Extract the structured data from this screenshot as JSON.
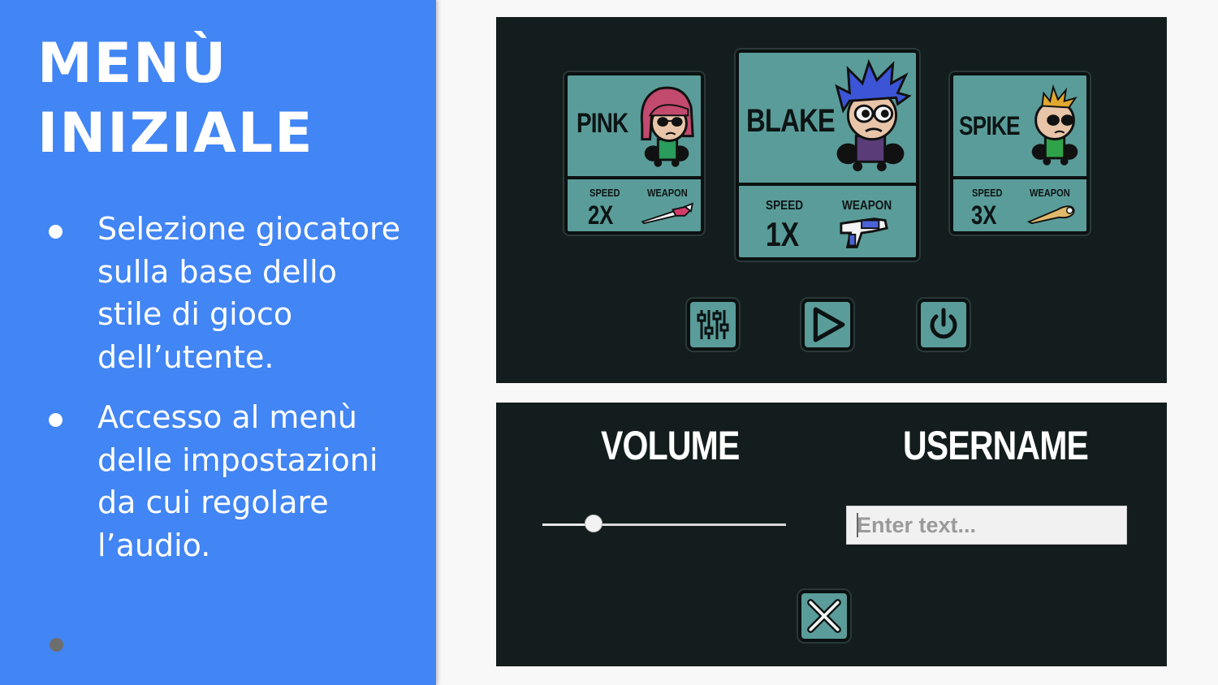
{
  "slide": {
    "title_line1": "MENÙ",
    "title_line2": "INIZIALE",
    "bullets": [
      "Selezione giocatore sulla base dello stile di gioco dell’utente.",
      "Accesso al menù delle impostazioni da cui regolare l’audio."
    ]
  },
  "characters": [
    {
      "name": "PINK",
      "speed_label": "SPEED",
      "speed_value": "2X",
      "weapon_label": "WEAPON",
      "weapon_icon": "spear-icon"
    },
    {
      "name": "BLAKE",
      "speed_label": "SPEED",
      "speed_value": "1X",
      "weapon_label": "WEAPON",
      "weapon_icon": "blaster-gun-icon"
    },
    {
      "name": "SPIKE",
      "speed_label": "SPEED",
      "speed_value": "3X",
      "weapon_label": "WEAPON",
      "weapon_icon": "baseball-bat-icon"
    }
  ],
  "menu_buttons": [
    {
      "icon": "sliders-icon"
    },
    {
      "icon": "play-icon"
    },
    {
      "icon": "power-icon"
    }
  ],
  "settings": {
    "volume_label": "VOLUME",
    "volume_level": 0.21,
    "username_label": "USERNAME",
    "username_placeholder": "Enter text...",
    "close_icon": "close-icon"
  },
  "colors": {
    "slide_blue": "#4285f4",
    "panel_dark": "#141d1d",
    "card_teal": "#5a9c99"
  }
}
